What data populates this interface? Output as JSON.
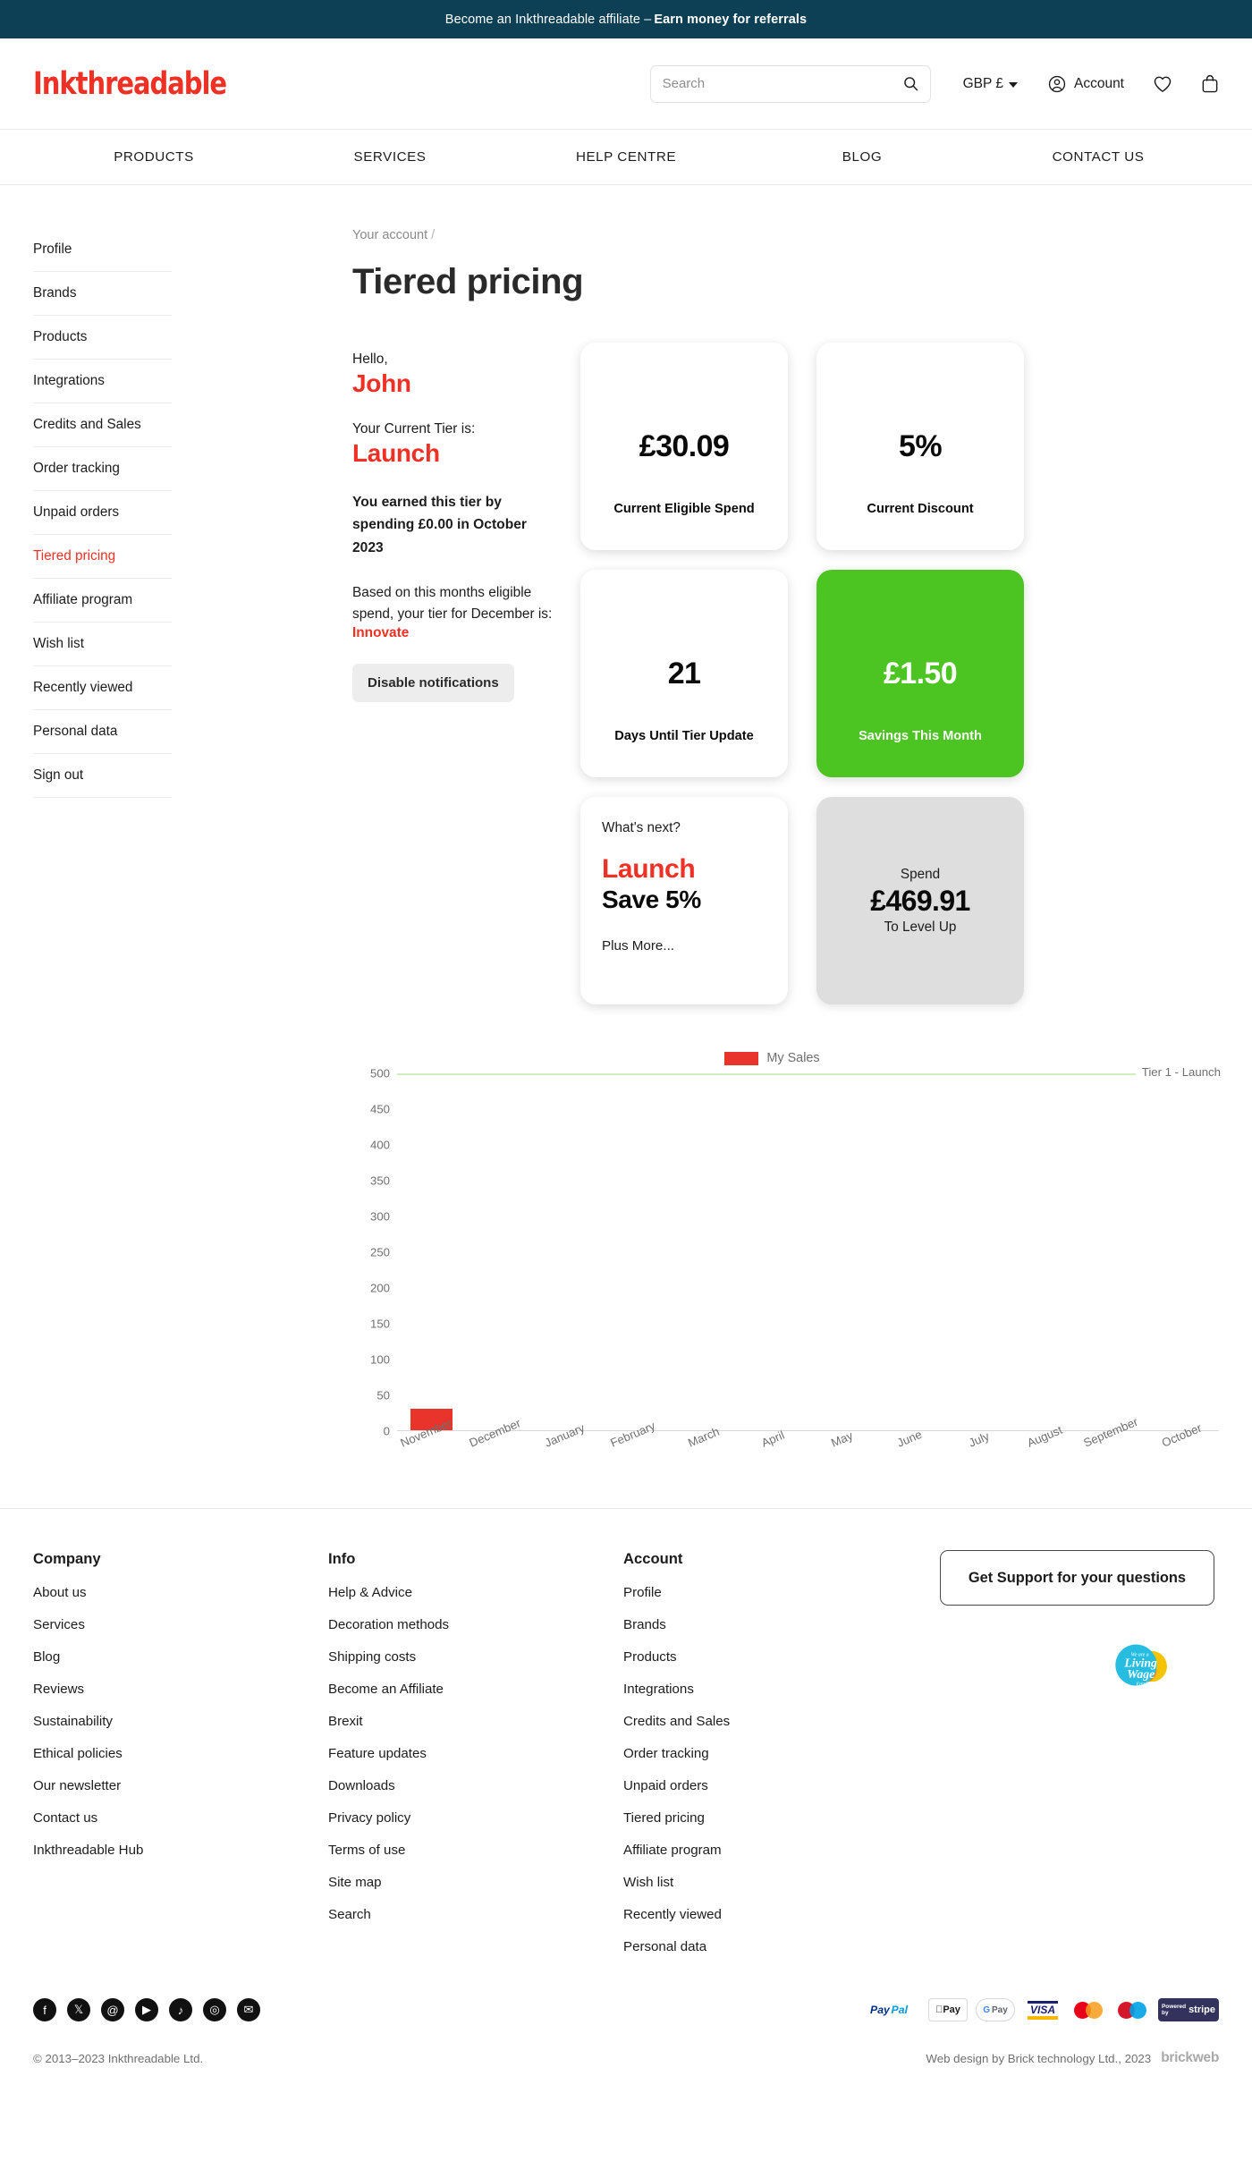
{
  "announcement": {
    "text": "Become an Inkthreadable affiliate – ",
    "strong": "Earn money for referrals"
  },
  "header": {
    "logo": "Inkthreadable",
    "search_placeholder": "Search",
    "search_value": "",
    "currency": "GBP £",
    "account": "Account"
  },
  "mainnav": {
    "items": [
      "PRODUCTS",
      "SERVICES",
      "HELP CENTRE",
      "BLOG",
      "CONTACT US"
    ]
  },
  "sidebar": {
    "items": [
      {
        "label": "Profile",
        "active": false
      },
      {
        "label": "Brands",
        "active": false
      },
      {
        "label": "Products",
        "active": false
      },
      {
        "label": "Integrations",
        "active": false
      },
      {
        "label": "Credits and Sales",
        "active": false
      },
      {
        "label": "Order tracking",
        "active": false
      },
      {
        "label": "Unpaid orders",
        "active": false
      },
      {
        "label": "Tiered pricing",
        "active": true
      },
      {
        "label": "Affiliate program",
        "active": false
      },
      {
        "label": "Wish list",
        "active": false
      },
      {
        "label": "Recently viewed",
        "active": false
      },
      {
        "label": "Personal data",
        "active": false
      },
      {
        "label": "Sign out",
        "active": false
      }
    ]
  },
  "main": {
    "breadcrumb": "Your account",
    "breadcrumb_sep": "/",
    "title": "Tiered pricing",
    "tier_text": {
      "hello": "Hello,",
      "name": "John",
      "current_tier_label": "Your Current Tier is:",
      "current_tier": "Launch",
      "earned": "You earned this tier by spending £0.00 in October 2023",
      "based_on": "Based on this months eligible spend, your tier for December is:",
      "next_tier": "Innovate",
      "disable_button": "Disable notifications"
    },
    "cards": {
      "eligible_spend_value": "£30.09",
      "eligible_spend_caption": "Current Eligible Spend",
      "discount_value": "5%",
      "discount_caption": "Current Discount",
      "days_value": "21",
      "days_caption": "Days Until Tier Update",
      "savings_value": "£1.50",
      "savings_caption": "Savings This Month",
      "whats_next": "What's next?",
      "next_tier_name": "Launch",
      "next_tier_save": "Save 5%",
      "plus_more": "Plus More...",
      "levelup_spend_label": "Spend",
      "levelup_amount": "£469.91",
      "levelup_sub": "To Level Up"
    }
  },
  "chart_data": {
    "type": "bar",
    "title": "",
    "xlabel": "",
    "ylabel": "",
    "categories": [
      "November",
      "December",
      "January",
      "February",
      "March",
      "April",
      "May",
      "June",
      "July",
      "August",
      "September",
      "October"
    ],
    "series": [
      {
        "name": "My Sales",
        "color": "#e8342a",
        "values": [
          30.09,
          0,
          0,
          0,
          0,
          0,
          0,
          0,
          0,
          0,
          0,
          0
        ]
      }
    ],
    "legend": [
      "My Sales"
    ],
    "legend_position": "top-center",
    "ylim": [
      0,
      500
    ],
    "yticks": [
      500,
      450,
      400,
      350,
      300,
      250,
      200,
      150,
      100,
      50,
      0
    ],
    "grid": false,
    "reference_lines": [
      {
        "label": "Tier 1 - Launch",
        "value": 500,
        "color": "#cdf0bc"
      }
    ]
  },
  "footer": {
    "columns": [
      {
        "heading": "Company",
        "links": [
          "About us",
          "Services",
          "Blog",
          "Reviews",
          "Sustainability",
          "Ethical policies",
          "Our newsletter",
          "Contact us",
          "Inkthreadable Hub"
        ]
      },
      {
        "heading": "Info",
        "links": [
          "Help & Advice",
          "Decoration methods",
          "Shipping costs",
          "Become an Affiliate",
          "Brexit",
          "Feature updates",
          "Downloads",
          "Privacy policy",
          "Terms of use",
          "Site map",
          "Search"
        ]
      },
      {
        "heading": "Account",
        "links": [
          "Profile",
          "Brands",
          "Products",
          "Integrations",
          "Credits and Sales",
          "Order tracking",
          "Unpaid orders",
          "Tiered pricing",
          "Affiliate program",
          "Wish list",
          "Recently viewed",
          "Personal data"
        ]
      }
    ],
    "support_button": "Get Support for your questions",
    "living_wage": {
      "line1": "We are a",
      "line2": "Living",
      "line3": "Wage",
      "line4": "Employer"
    }
  },
  "bottom": {
    "social": [
      {
        "name": "facebook-icon",
        "glyph": "f"
      },
      {
        "name": "x-twitter-icon",
        "glyph": "𝕏"
      },
      {
        "name": "threads-icon",
        "glyph": "@"
      },
      {
        "name": "youtube-icon",
        "glyph": "▶"
      },
      {
        "name": "tiktok-icon",
        "glyph": "♪"
      },
      {
        "name": "instagram-icon",
        "glyph": "◎"
      },
      {
        "name": "email-icon",
        "glyph": "✉"
      }
    ],
    "payments": [
      "PayPal",
      "Pay",
      "G Pay",
      "VISA",
      "mastercard",
      "maestro",
      "stripe"
    ],
    "copyright": "© 2013–2023 Inkthreadable Ltd.",
    "web_design": "Web design by Brick technology Ltd., 2023",
    "brickweb": "brickweb"
  },
  "colors": {
    "brand_red": "#ee3124",
    "dark_teal": "#0d4054",
    "green": "#4cc421",
    "chart_red": "#e8342a"
  }
}
